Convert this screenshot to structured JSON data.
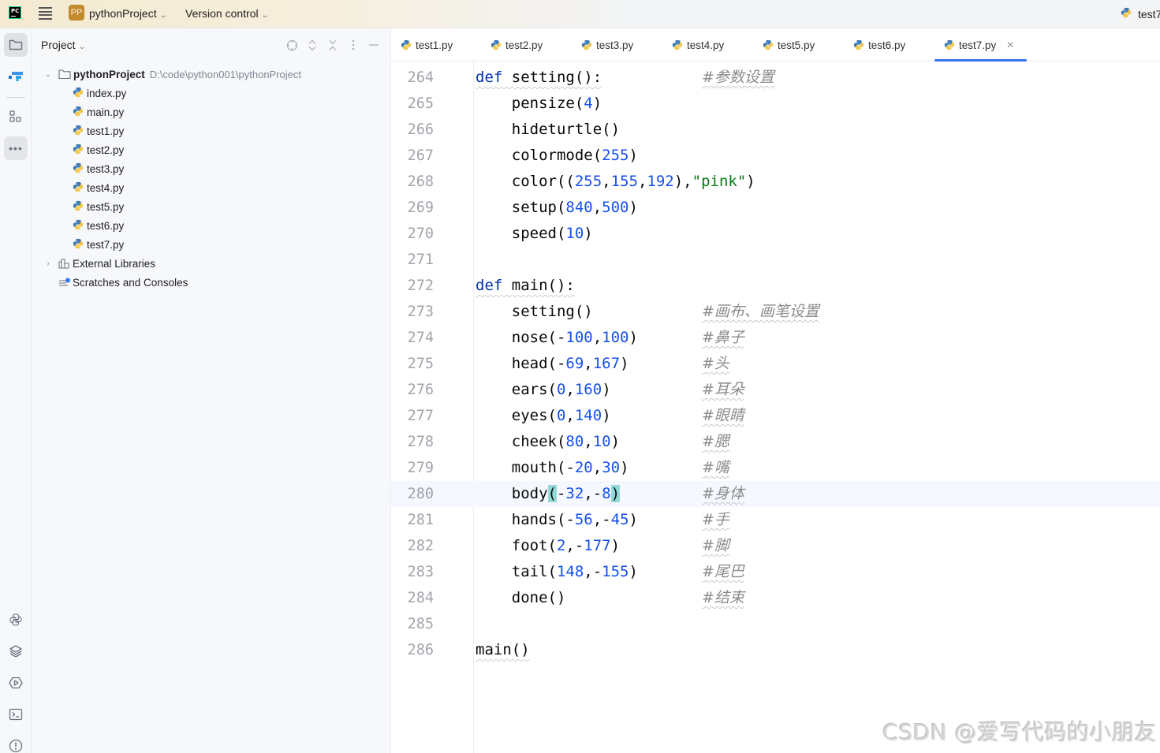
{
  "titlebar": {
    "app_logo": "PC",
    "project_badge": "PP",
    "project_name": "pythonProject",
    "vcs_label": "Version control",
    "run_config": "test7"
  },
  "toolstrip": {
    "top": [
      "folder-icon",
      "plugin-icon",
      "structure-icon",
      "more-icon"
    ],
    "bottom": [
      "python-console-icon",
      "layers-icon",
      "services-icon",
      "terminal-icon",
      "problems-icon"
    ]
  },
  "project_panel": {
    "title": "Project",
    "actions": [
      "locate-icon",
      "expand-icon",
      "collapse-icon",
      "options-icon",
      "hide-icon"
    ],
    "root": {
      "name": "pythonProject",
      "path": "D:\\code\\python001\\pythonProject"
    },
    "files": [
      "index.py",
      "main.py",
      "test1.py",
      "test2.py",
      "test3.py",
      "test4.py",
      "test5.py",
      "test6.py",
      "test7.py"
    ],
    "external_libraries": "External Libraries",
    "scratches": "Scratches and Consoles"
  },
  "tabs": [
    {
      "label": "test1.py"
    },
    {
      "label": "test2.py"
    },
    {
      "label": "test3.py"
    },
    {
      "label": "test4.py"
    },
    {
      "label": "test5.py"
    },
    {
      "label": "test6.py"
    },
    {
      "label": "test7.py",
      "active": true
    }
  ],
  "editor": {
    "current_line": 280,
    "lines": [
      {
        "n": "264",
        "comment": "#参数设置"
      },
      {
        "n": "265",
        "comment": ""
      },
      {
        "n": "266",
        "comment": ""
      },
      {
        "n": "267",
        "comment": ""
      },
      {
        "n": "268",
        "comment": ""
      },
      {
        "n": "269",
        "comment": ""
      },
      {
        "n": "270",
        "comment": ""
      },
      {
        "n": "271",
        "comment": ""
      },
      {
        "n": "272",
        "comment": ""
      },
      {
        "n": "273",
        "comment": "#画布、画笔设置"
      },
      {
        "n": "274",
        "comment": "#鼻子"
      },
      {
        "n": "275",
        "comment": "#头"
      },
      {
        "n": "276",
        "comment": "#耳朵"
      },
      {
        "n": "277",
        "comment": "#眼睛"
      },
      {
        "n": "278",
        "comment": "#腮"
      },
      {
        "n": "279",
        "comment": "#嘴"
      },
      {
        "n": "280",
        "comment": "#身体"
      },
      {
        "n": "281",
        "comment": "#手"
      },
      {
        "n": "282",
        "comment": "#脚"
      },
      {
        "n": "283",
        "comment": "#尾巴"
      },
      {
        "n": "284",
        "comment": "#结束"
      },
      {
        "n": "285",
        "comment": ""
      },
      {
        "n": "286",
        "comment": ""
      }
    ],
    "tokens": {
      "l264": [
        [
          "kw",
          "def"
        ],
        [
          "",
          " setting():"
        ]
      ],
      "l265": [
        [
          "",
          "    pensize("
        ],
        [
          "num",
          "4"
        ],
        [
          "",
          ")"
        ]
      ],
      "l266": [
        [
          "",
          "    hideturtle()"
        ]
      ],
      "l267": [
        [
          "",
          "    colormode("
        ],
        [
          "num",
          "255"
        ],
        [
          "",
          ")"
        ]
      ],
      "l268": [
        [
          "",
          "    color(("
        ],
        [
          "num",
          "255"
        ],
        [
          "",
          ","
        ],
        [
          "num",
          "155"
        ],
        [
          "",
          ","
        ],
        [
          "num",
          "192"
        ],
        [
          "",
          "),"
        ],
        [
          "str",
          "\"pink\""
        ],
        [
          "",
          ")"
        ]
      ],
      "l269": [
        [
          "",
          "    setup("
        ],
        [
          "num",
          "840"
        ],
        [
          "",
          ","
        ],
        [
          "num",
          "500"
        ],
        [
          "",
          ")"
        ]
      ],
      "l270": [
        [
          "",
          "    speed("
        ],
        [
          "num",
          "10"
        ],
        [
          "",
          ")"
        ]
      ],
      "l271": [],
      "l272": [
        [
          "kw",
          "def"
        ],
        [
          "",
          " main():"
        ]
      ],
      "l273": [
        [
          "",
          "    setting()"
        ]
      ],
      "l274": [
        [
          "",
          "    nose(-"
        ],
        [
          "num",
          "100"
        ],
        [
          "",
          ","
        ],
        [
          "num",
          "100"
        ],
        [
          "",
          ")"
        ]
      ],
      "l275": [
        [
          "",
          "    head(-"
        ],
        [
          "num",
          "69"
        ],
        [
          "",
          ","
        ],
        [
          "num",
          "167"
        ],
        [
          "",
          ")"
        ]
      ],
      "l276": [
        [
          "",
          "    ears("
        ],
        [
          "num",
          "0"
        ],
        [
          "",
          ","
        ],
        [
          "num",
          "160"
        ],
        [
          "",
          ")"
        ]
      ],
      "l277": [
        [
          "",
          "    eyes("
        ],
        [
          "num",
          "0"
        ],
        [
          "",
          ","
        ],
        [
          "num",
          "140"
        ],
        [
          "",
          ")"
        ]
      ],
      "l278": [
        [
          "",
          "    cheek("
        ],
        [
          "num",
          "80"
        ],
        [
          "",
          ","
        ],
        [
          "num",
          "10"
        ],
        [
          "",
          ")"
        ]
      ],
      "l279": [
        [
          "",
          "    mouth(-"
        ],
        [
          "num",
          "20"
        ],
        [
          "",
          ","
        ],
        [
          "num",
          "30"
        ],
        [
          "",
          ")"
        ]
      ],
      "l280": [
        [
          "",
          "    body"
        ],
        [
          "brace",
          "("
        ],
        [
          "",
          "-"
        ],
        [
          "num",
          "32"
        ],
        [
          "",
          ",-"
        ],
        [
          "num",
          "8"
        ],
        [
          "brace",
          ")"
        ]
      ],
      "l281": [
        [
          "",
          "    hands(-"
        ],
        [
          "num",
          "56"
        ],
        [
          "",
          ",-"
        ],
        [
          "num",
          "45"
        ],
        [
          "",
          ")"
        ]
      ],
      "l282": [
        [
          "",
          "    foot("
        ],
        [
          "num",
          "2"
        ],
        [
          "",
          ",-"
        ],
        [
          "num",
          "177"
        ],
        [
          "",
          ")"
        ]
      ],
      "l283": [
        [
          "",
          "    tail("
        ],
        [
          "num",
          "148"
        ],
        [
          "",
          ",-"
        ],
        [
          "num",
          "155"
        ],
        [
          "",
          ")"
        ]
      ],
      "l284": [
        [
          "",
          "    done()"
        ]
      ],
      "l285": [],
      "l286": [
        [
          "",
          "main()"
        ]
      ]
    }
  },
  "watermark": "CSDN @爱写代码的小朋友",
  "colors": {
    "accent": "#3574f0",
    "keyword": "#0033b3",
    "number": "#1750eb",
    "string": "#067d17",
    "comment": "#8c8c8c",
    "brace_match": "#93d9d9",
    "project_badge": "#c3892a"
  }
}
